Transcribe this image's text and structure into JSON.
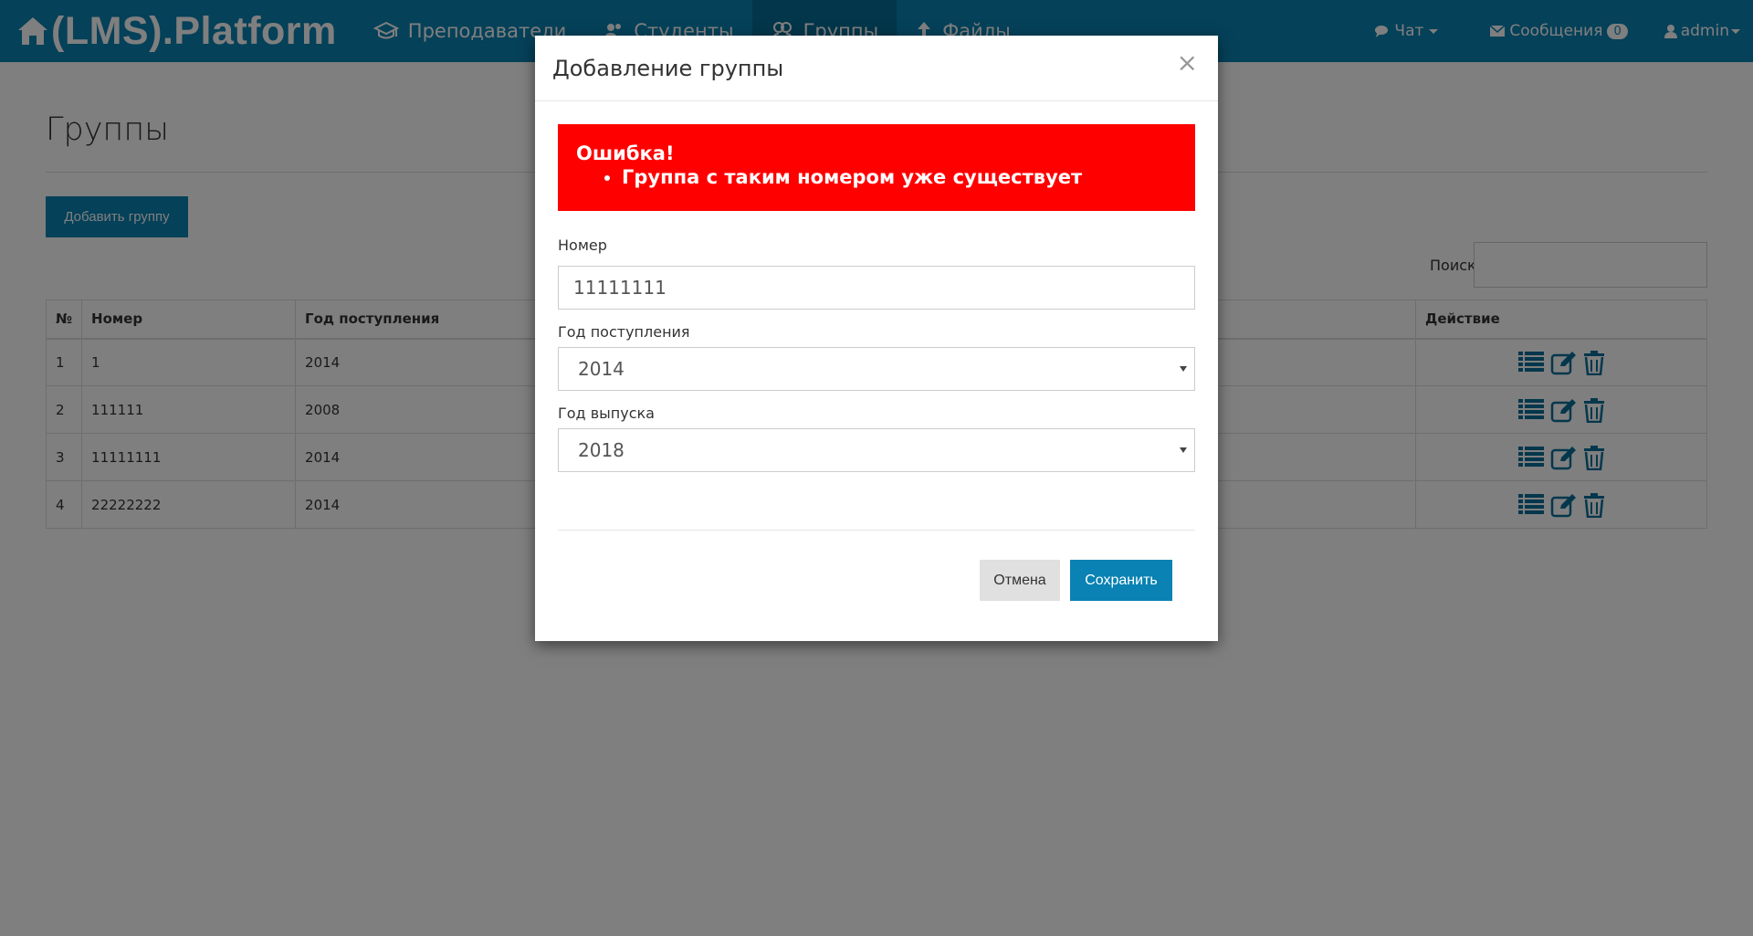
{
  "navbar": {
    "brand": "(LMS).Platform",
    "links": [
      {
        "label": "Преподаватели",
        "icon": "graduation-cap-icon"
      },
      {
        "label": "Студенты",
        "icon": "users-icon"
      },
      {
        "label": "Группы",
        "icon": "groups-icon",
        "active": true
      },
      {
        "label": "Файлы",
        "icon": "upload-icon"
      }
    ],
    "chat": "Чат",
    "messages": "Сообщения",
    "messages_count": "0",
    "user": "admin"
  },
  "page": {
    "title": "Группы",
    "add_button": "Добавить группу",
    "search_label": "Поиск"
  },
  "table": {
    "headers": [
      "№",
      "Номер",
      "Год поступления",
      "Действие"
    ],
    "rows": [
      {
        "n": "1",
        "number": "1",
        "year": "2014"
      },
      {
        "n": "2",
        "number": "111111",
        "year": "2008"
      },
      {
        "n": "3",
        "number": "11111111",
        "year": "2014"
      },
      {
        "n": "4",
        "number": "22222222",
        "year": "2014"
      }
    ]
  },
  "modal": {
    "title": "Добавление группы",
    "close": "×",
    "error_title": "Ошибка!",
    "error_item": "Группа с таким номером уже существует",
    "number_label": "Номер",
    "number_value": "11111111",
    "enroll_label": "Год поступления",
    "enroll_value": "2014",
    "grad_label": "Год выпуска",
    "grad_value": "2018",
    "cancel": "Отмена",
    "save": "Сохранить"
  },
  "colors": {
    "primary": "#0a82b3",
    "error": "#ff0000"
  }
}
